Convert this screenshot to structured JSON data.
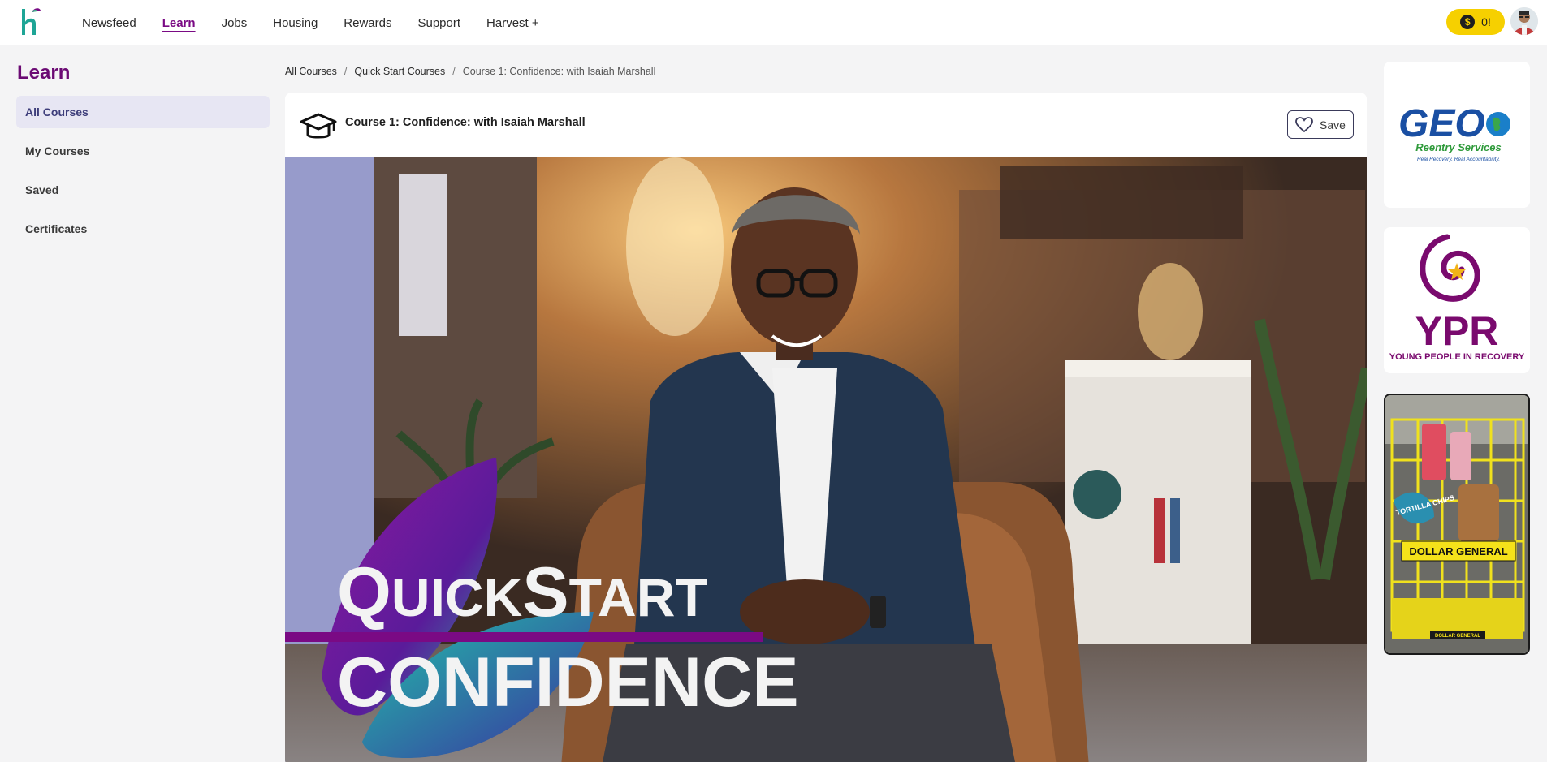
{
  "nav": {
    "items": [
      {
        "label": "Newsfeed",
        "active": false
      },
      {
        "label": "Learn",
        "active": true
      },
      {
        "label": "Jobs",
        "active": false
      },
      {
        "label": "Housing",
        "active": false
      },
      {
        "label": "Rewards",
        "active": false
      },
      {
        "label": "Support",
        "active": false
      },
      {
        "label": "Harvest +",
        "active": false
      }
    ],
    "coins": "0!",
    "accent": "#7a0a84",
    "coin_color": "#f6d000"
  },
  "sidebar": {
    "title": "Learn",
    "items": [
      {
        "label": "All Courses",
        "active": true
      },
      {
        "label": "My Courses",
        "active": false
      },
      {
        "label": "Saved",
        "active": false
      },
      {
        "label": "Certificates",
        "active": false
      }
    ]
  },
  "breadcrumb": {
    "items": [
      "All Courses",
      "Quick Start Courses",
      "Course 1: Confidence: with Isaiah Marshall"
    ],
    "separator": "/"
  },
  "course": {
    "title": "Course 1: Confidence: with Isaiah Marshall",
    "save_label": "Save",
    "hero": {
      "line1_big_q": "Q",
      "line1_uick": "UICK",
      "line1_big_s": "S",
      "line1_tart": "TART",
      "line2": "CONFIDENCE"
    }
  },
  "ads": {
    "geo": {
      "brand": "GEO",
      "sub": "Reentry Services",
      "tagline": "Real Recovery. Real Accountability."
    },
    "ypr": {
      "brand": "YPR",
      "sub": "YOUNG PEOPLE IN RECOVERY"
    },
    "dollar_general": {
      "brand": "DOLLAR GENERAL",
      "small": "DOLLAR GENERAL",
      "chips": "TORTILLA CHIPS"
    }
  }
}
